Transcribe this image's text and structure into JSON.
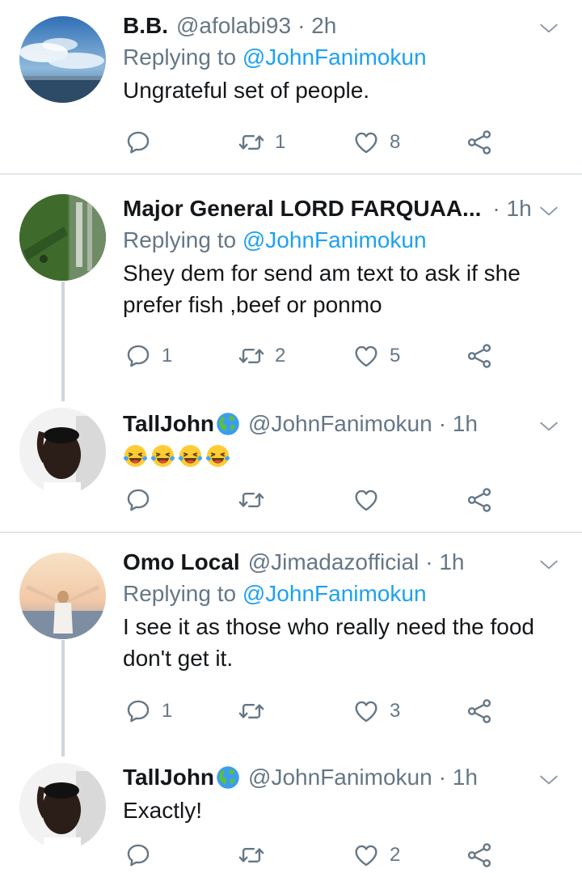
{
  "tweets": [
    {
      "name": "B.B.",
      "handle": "@afolabi93",
      "time": "· 2h",
      "replying_prefix": "Replying to ",
      "replying_to": "@JohnFanimokun",
      "text": "Ungrateful set of people.",
      "reply_count": "",
      "retweet_count": "1",
      "like_count": "8"
    },
    {
      "name": "Major General LORD FARQUAA...",
      "handle": "",
      "time": "· 1h",
      "replying_prefix": "Replying to ",
      "replying_to": "@JohnFanimokun",
      "text": "Shey dem for send am text to ask if she prefer fish ,beef or ponmo",
      "reply_count": "1",
      "retweet_count": "2",
      "like_count": "5"
    },
    {
      "name": "TallJohn",
      "handle": "@JohnFanimokun",
      "time": "· 1h",
      "text": "",
      "emoji": "😂😂😂😂",
      "reply_count": "",
      "retweet_count": "",
      "like_count": ""
    },
    {
      "name": "Omo Local",
      "handle": "@Jimadazofficial",
      "time": "· 1h",
      "replying_prefix": "Replying to ",
      "replying_to": "@JohnFanimokun",
      "text": "I see it as those who really need the food don't get it.",
      "reply_count": "1",
      "retweet_count": "",
      "like_count": "3"
    },
    {
      "name": "TallJohn",
      "handle": "@JohnFanimokun",
      "time": "· 1h",
      "text": "Exactly!",
      "reply_count": "",
      "retweet_count": "",
      "like_count": "2"
    }
  ],
  "colors": {
    "accent": "#1da1f2",
    "secondary_text": "#657786",
    "icon": "#657786",
    "divider": "#e1e8ed",
    "thread_line": "#ccd6dd"
  },
  "icons": [
    "reply-icon",
    "retweet-icon",
    "like-icon",
    "share-icon",
    "caret-down-icon",
    "globe-emoji-icon",
    "laughing-emoji-icon"
  ]
}
